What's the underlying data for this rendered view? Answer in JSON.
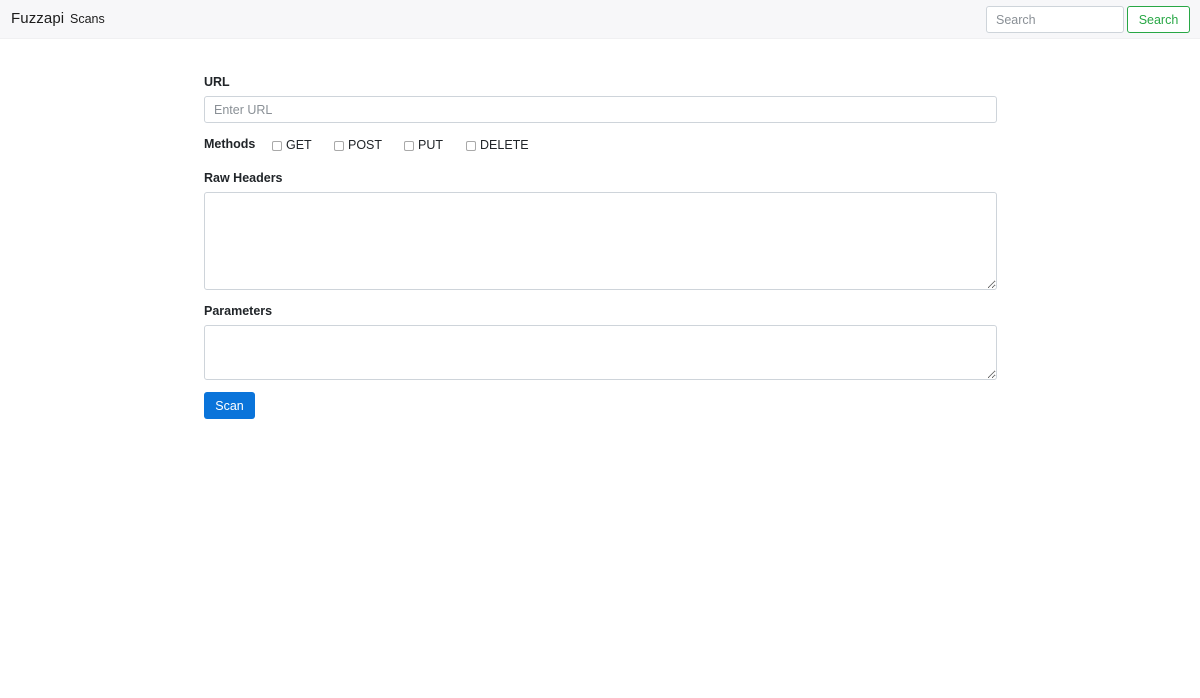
{
  "navbar": {
    "brand": "Fuzzapi",
    "links": [
      {
        "label": "Scans"
      }
    ],
    "search": {
      "placeholder": "Search",
      "value": "",
      "button_label": "Search"
    }
  },
  "form": {
    "url": {
      "label": "URL",
      "placeholder": "Enter URL",
      "value": ""
    },
    "methods": {
      "label": "Methods",
      "options": [
        {
          "label": "GET",
          "checked": false
        },
        {
          "label": "POST",
          "checked": false
        },
        {
          "label": "PUT",
          "checked": false
        },
        {
          "label": "DELETE",
          "checked": false
        }
      ]
    },
    "raw_headers": {
      "label": "Raw Headers",
      "value": ""
    },
    "parameters": {
      "label": "Parameters",
      "value": ""
    },
    "submit_label": "Scan"
  },
  "colors": {
    "navbar_bg": "#f7f7f9",
    "primary": "#0a74da",
    "success": "#28a745"
  }
}
